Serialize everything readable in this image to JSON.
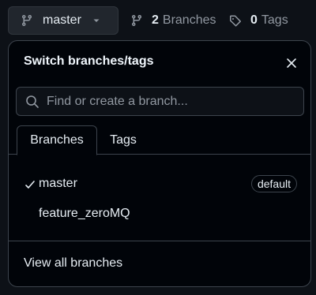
{
  "branch_selector": {
    "current_branch": "master",
    "branch_count": "2",
    "branches_label": "Branches",
    "tag_count": "0",
    "tags_label": "Tags"
  },
  "dropdown": {
    "title": "Switch branches/tags",
    "search_placeholder": "Find or create a branch...",
    "tabs": [
      {
        "label": "Branches",
        "active": true
      },
      {
        "label": "Tags",
        "active": false
      }
    ],
    "branches": [
      {
        "name": "master",
        "selected": true,
        "badge": "default"
      },
      {
        "name": "feature_zeroMQ",
        "selected": false,
        "badge": ""
      }
    ],
    "footer_link": "View all branches"
  },
  "colors": {
    "background": "#0d1117",
    "panel": "#010409",
    "border": "#3d444d",
    "text": "#e6edf3",
    "muted": "#9198a1"
  }
}
